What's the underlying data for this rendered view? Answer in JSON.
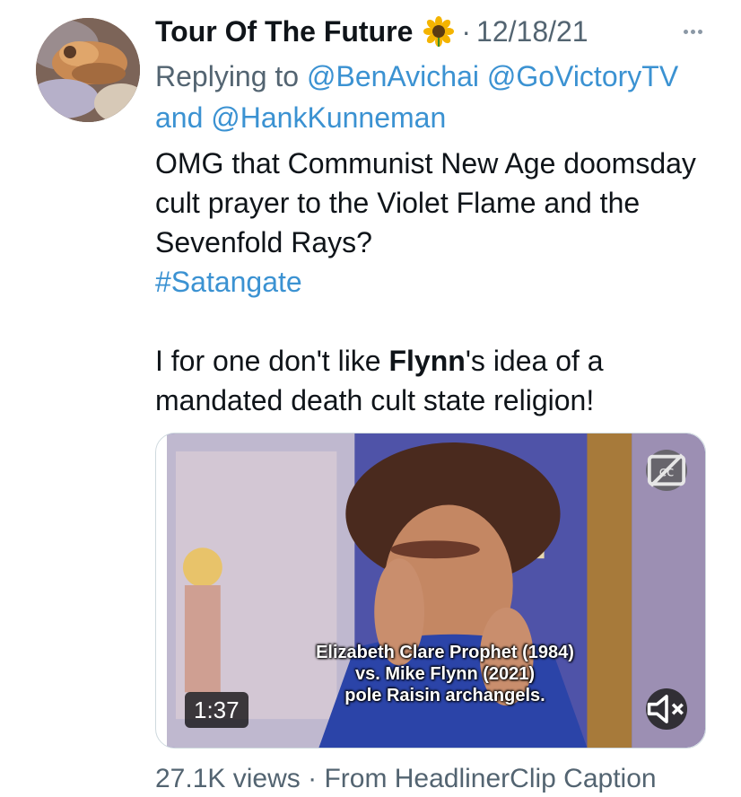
{
  "tweet": {
    "author": "Tour Of The Future",
    "emoji": "🌻",
    "separator": "·",
    "date": "12/18/21",
    "more_icon": "more-horizontal-icon",
    "replying_prefix": "Replying to",
    "mentions": [
      "@BenAvichai",
      "@GoVictoryTV"
    ],
    "mentions_joiner": "and",
    "mention_last": "@HankKunneman",
    "body_line1": "OMG that Communist New Age doomsday cult prayer to the Violet Flame and the Sevenfold Rays?",
    "hashtag": "#Satangate",
    "body2_pre": "I for one don't like ",
    "body2_bold": "Flynn",
    "body2_post": "'s idea of a mandated death cult state religion!",
    "media": {
      "caption_lines": [
        "Elizabeth Clare Prophet (1984)",
        "vs. Mike Flynn (2021)",
        "pole Raisin archangels."
      ],
      "duration": "1:37",
      "cc_icon": "closed-captions-icon",
      "mute_icon": "speaker-muted-icon"
    },
    "views": "27.1K views",
    "footer_sep": "·",
    "source": "From HeadlinerClip Caption"
  },
  "colors": {
    "text": "#0f1419",
    "secondary": "#536471",
    "link": "#3b92d2",
    "border": "#cfd9de"
  }
}
